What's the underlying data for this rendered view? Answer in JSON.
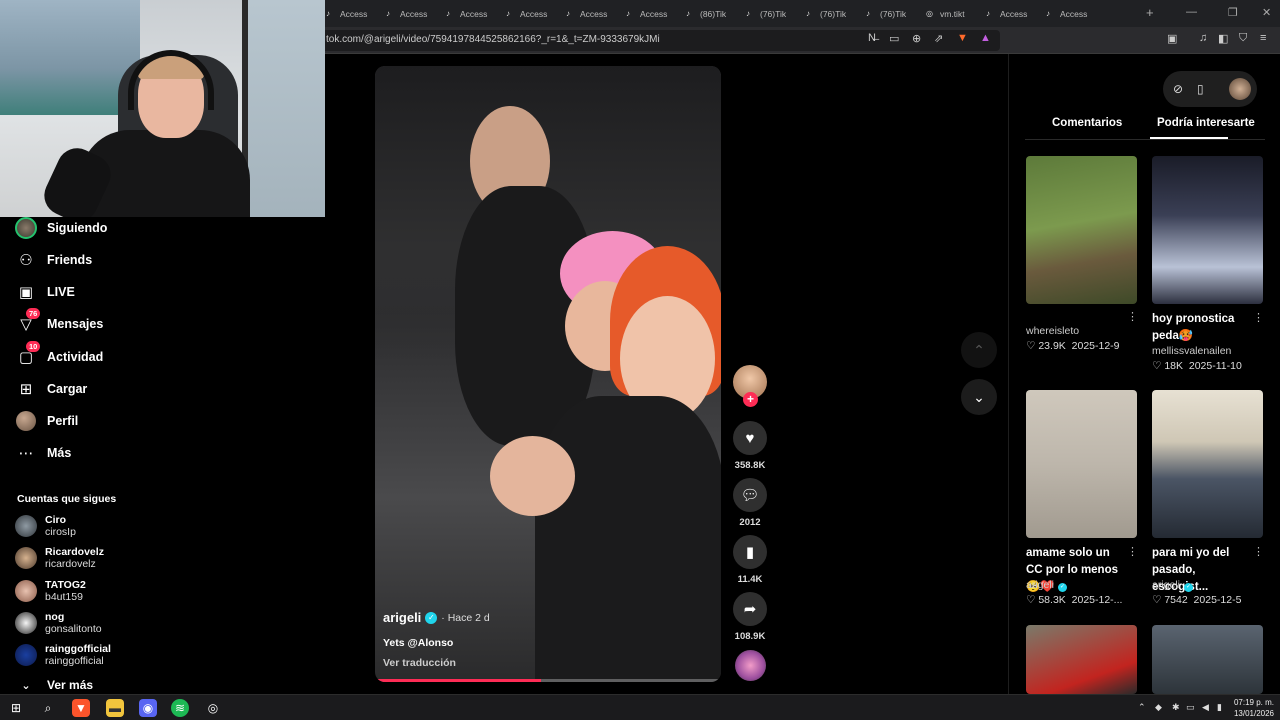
{
  "browser": {
    "tabs": [
      {
        "label": "Access",
        "icon": "tiktok-icon"
      },
      {
        "label": "Access",
        "icon": "tiktok-icon"
      },
      {
        "label": "Access",
        "icon": "tiktok-icon"
      },
      {
        "label": "Access",
        "icon": "tiktok-icon"
      },
      {
        "label": "Access",
        "icon": "tiktok-icon"
      },
      {
        "label": "Access",
        "icon": "tiktok-icon"
      },
      {
        "label": "(86)Tik",
        "icon": "tiktok-icon"
      },
      {
        "label": "(76)Tik",
        "icon": "tiktok-icon"
      },
      {
        "label": "(76)Tik",
        "icon": "tiktok-icon"
      },
      {
        "label": "(76)Tik",
        "icon": "tiktok-icon"
      },
      {
        "label": "vm.tikt",
        "icon": "globe-icon"
      },
      {
        "label": "Access",
        "icon": "tiktok-icon"
      },
      {
        "label": "Access",
        "icon": "tiktok-icon"
      }
    ],
    "url": "tok.com/@arigeli/video/7594197844525862166?_r=1&_t=ZM-9333679kJMi"
  },
  "nav": {
    "items": [
      {
        "label": "Siguiendo",
        "icon": "following-avatar-icon"
      },
      {
        "label": "Friends",
        "icon": "friends-icon"
      },
      {
        "label": "LIVE",
        "icon": "live-icon"
      },
      {
        "label": "Mensajes",
        "icon": "messages-icon",
        "badge": "76"
      },
      {
        "label": "Actividad",
        "icon": "activity-icon",
        "badge": "10"
      },
      {
        "label": "Cargar",
        "icon": "upload-icon"
      },
      {
        "label": "Perfil",
        "icon": "profile-avatar-icon"
      },
      {
        "label": "Más",
        "icon": "more-icon"
      }
    ],
    "following_title": "Cuentas que sigues",
    "following": [
      {
        "name": "Ciro",
        "handle": "cirosIp"
      },
      {
        "name": "Ricardovelz",
        "handle": "ricardovelz"
      },
      {
        "name": "TATOG2",
        "handle": "b4ut159"
      },
      {
        "name": "nog",
        "handle": "gonsalitonto"
      },
      {
        "name": "rainggofficial",
        "handle": "rainggofficial"
      }
    ],
    "see_more": "Ver más"
  },
  "video": {
    "author": "arigeli",
    "time": "· Hace 2 d",
    "caption": "Yets @Alonso",
    "translate": "Ver traducción",
    "progress": 0.48,
    "likes": "358.8K",
    "comments": "2012",
    "saves": "11.4K",
    "shares": "108.9K"
  },
  "right_panel": {
    "tabs": [
      "Comentarios",
      "Podría interesarte"
    ],
    "active_tab": "Podría interesarte",
    "cards": [
      {
        "title": "",
        "user": "whereisleto",
        "likes": "23.9K",
        "date": "2025-12-9"
      },
      {
        "title": "hoy pronostica peda🥵",
        "user": "mellissvalenailen",
        "likes": "18K",
        "date": "2025-11-10"
      },
      {
        "title": "amame solo un CC por lo menos🥺❤️",
        "user": "arigeli",
        "likes": "58.3K",
        "date": "2025-12-...",
        "verified": true
      },
      {
        "title": "para mi yo del pasado, escogist...",
        "user": "arigeli",
        "likes": "7542",
        "date": "2025-12-5",
        "verified": true
      }
    ]
  },
  "taskbar": {
    "time": "07:19 p. m.",
    "date": "13/01/2026"
  },
  "colors": {
    "accent": "#fe2c55",
    "verified": "#20d5ec",
    "background": "#000000"
  }
}
